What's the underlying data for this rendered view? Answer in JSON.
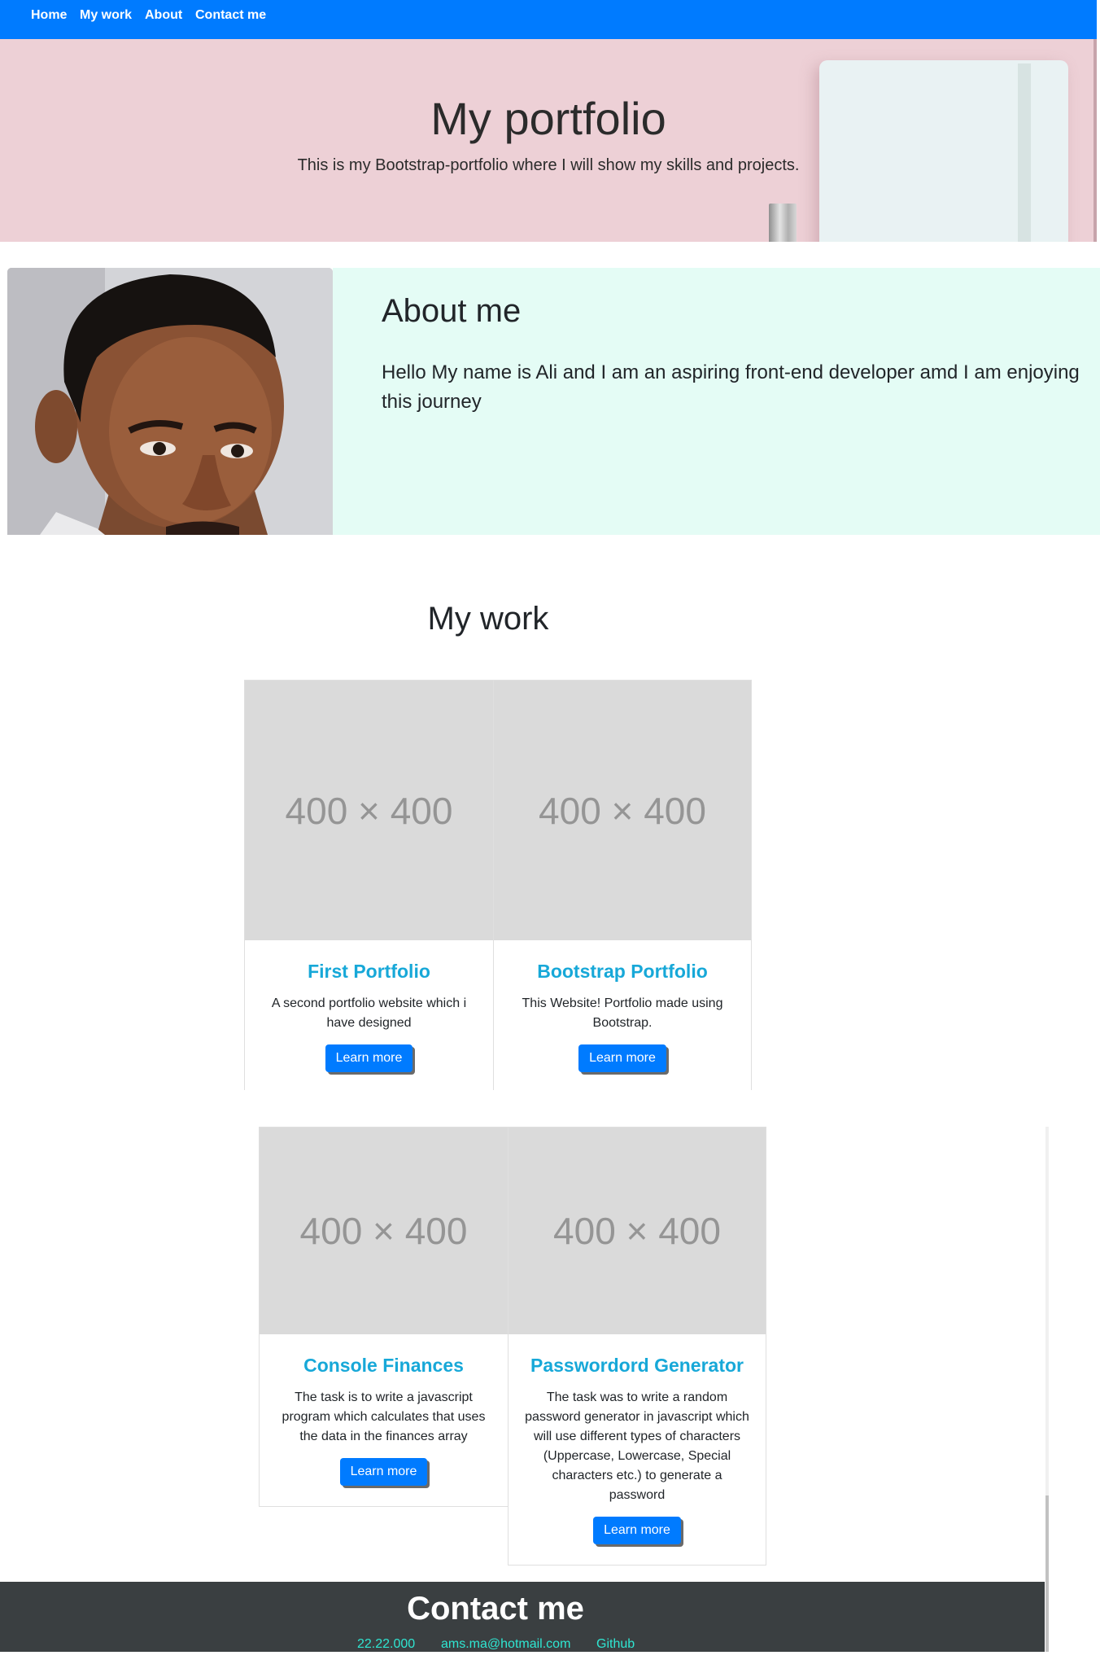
{
  "navbar": {
    "items": [
      {
        "label": "Home"
      },
      {
        "label": "My work"
      },
      {
        "label": "About"
      },
      {
        "label": "Contact me"
      }
    ]
  },
  "hero": {
    "title": "My portfolio",
    "subtitle": "This is my Bootstrap-portfolio where I will show my skills and projects."
  },
  "about": {
    "title": "About me",
    "text": "Hello My name is Ali and I am an aspiring front-end developer amd I am enjoying this journey"
  },
  "work": {
    "title": "My work",
    "placeholder": "400 × 400",
    "button_label": "Learn more",
    "projects": [
      {
        "title": "First Portfolio",
        "text": "A second portfolio website which i have designed"
      },
      {
        "title": "Bootstrap Portfolio",
        "text": "This Website! Portfolio made using Bootstrap."
      },
      {
        "title": "Console Finances",
        "text": "The task is to write a javascript program which calculates that uses the data in the finances array"
      },
      {
        "title": "Passwordord Generator",
        "text": "The task was to write a random password generator in javascript which will use different types of characters (Uppercase, Lowercase, Special characters etc.) to generate a password"
      }
    ]
  },
  "footer": {
    "title": "Contact me",
    "links": [
      {
        "label": "22.22.000"
      },
      {
        "label": "ams.ma@hotmail.com"
      },
      {
        "label": "Github"
      }
    ]
  },
  "colors": {
    "primary": "#007bff",
    "hero_bg": "#edd0d6",
    "about_bg": "#e4fcf5",
    "card_title": "#17a8d8",
    "footer_bg": "#3a3f41",
    "footer_link": "#2fe6d2"
  }
}
